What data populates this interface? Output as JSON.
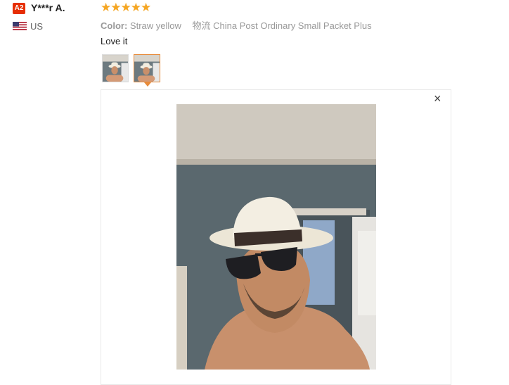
{
  "reviewer": {
    "badge": "A2",
    "name": "Y***r A.",
    "country": "US"
  },
  "review": {
    "rating": 5,
    "stars": "★★★★★",
    "color_label": "Color:",
    "color_value": "Straw yellow",
    "logistics_label": "物流",
    "logistics_value": "China Post Ordinary Small Packet Plus",
    "comment": "Love it"
  },
  "viewer": {
    "close": "×",
    "selected_thumbnail": 2
  },
  "colors": {
    "badge": "#e62e04",
    "stars": "#f5a623",
    "thumb_selected": "#e88b3a"
  }
}
